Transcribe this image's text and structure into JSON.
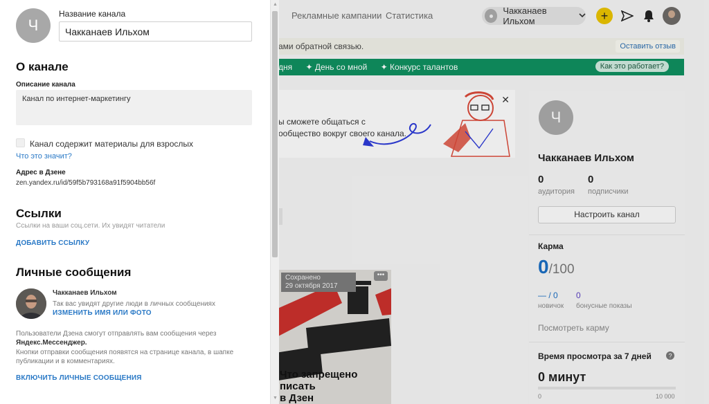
{
  "topbar": {
    "nav": [
      "Рекламные кампании",
      "Статистика"
    ],
    "user_name": "Чакканаев Ильхом"
  },
  "feedback": {
    "text": "ами обратной связью.",
    "button": "Оставить отзыв"
  },
  "green_bar": {
    "items": [
      "дня",
      "✦ День со мной",
      "✦ Конкурс талантов"
    ],
    "help": "Как это работает?"
  },
  "promo": {
    "line1": "ы сможете общаться с",
    "line2": "ообщество вокруг своего канала."
  },
  "card": {
    "saved": "Сохранено",
    "date": "29 октября 2017",
    "title1": "Что запрещено писать",
    "title2": "в Дзен"
  },
  "right_panel": {
    "avatar_letter": "Ч",
    "name": "Чакканаев Ильхом",
    "audience_value": "0",
    "audience_label": "аудитория",
    "subscribers_value": "0",
    "subscribers_label": "подписчики",
    "setup_button": "Настроить канал",
    "karma_title": "Карма",
    "karma_value": "0",
    "karma_total": "/100",
    "novice_value": "— / 0",
    "novice_label": "новичок",
    "bonus_value": "0",
    "bonus_label": "бонусные показы",
    "karma_link": "Посмотреть карму",
    "watch_title": "Время просмотра за 7 дней",
    "watch_value": "0 минут",
    "scale_min": "0",
    "scale_max": "10 000"
  },
  "drawer": {
    "avatar_letter": "Ч",
    "channel_name_label": "Название канала",
    "channel_name_value": "Чакканаев Ильхом",
    "about_title": "О канале",
    "description_label": "Описание канала",
    "description_value": "Канал по интернет-маркетингу",
    "adult_label": "Канал содержит материалы для взрослых",
    "what_link": "Что это значит?",
    "address_label": "Адрес в Дзене",
    "address_value": "zen.yandex.ru/id/59f5b793168a91f5904bb56f",
    "links_title": "Ссылки",
    "links_hint": "Ссылки на ваши соц.сети. Их увидят читатели",
    "add_link": "ДОБАВИТЬ ССЫЛКУ",
    "pm_title": "Личные сообщения",
    "pm_name": "Чакканаев Ильхом",
    "pm_hint": "Так вас увидят другие люди в личных сообщениях",
    "pm_change": "ИЗМЕНИТЬ ИМЯ ИЛИ ФОТО",
    "pm_info1_a": "Пользователи Дзена смогут отправлять вам сообщения через",
    "pm_info1_b": "Яндекс.Мессенджер.",
    "pm_info2_a": "Кнопки отправки сообщения появятся на странице канала, в шапке",
    "pm_info2_b": "публикации и в комментариях.",
    "pm_enable": "ВКЛЮЧИТЬ ЛИЧНЫЕ СООБЩЕНИЯ"
  },
  "colors": {
    "accent": "#2a79c6",
    "green": "#0f8f5f",
    "yellow": "#e8c200",
    "karma": "#1b6ec2"
  }
}
